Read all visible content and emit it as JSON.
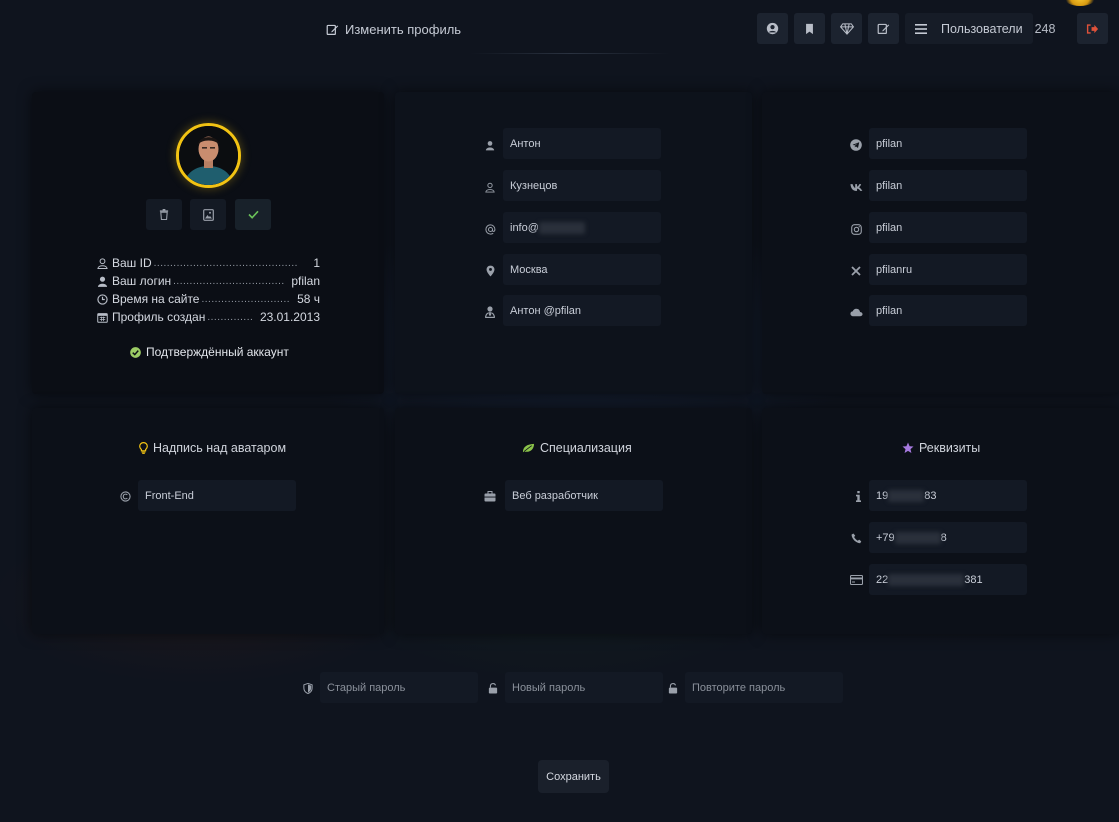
{
  "header": {
    "title": "Изменить профиль",
    "users_label": "Пользователи",
    "users_count": "248"
  },
  "profile": {
    "info": [
      {
        "label": "Ваш ID",
        "dots": "............................................",
        "value": "1"
      },
      {
        "label": "Ваш логин",
        "dots": "..................................",
        "value": "pfilan"
      },
      {
        "label": "Время на сайте",
        "dots": "...........................",
        "value": "58  ч"
      },
      {
        "label": "Профиль создан",
        "dots": "..............",
        "value": "23.01.2013"
      }
    ],
    "verified": "Подтверждённый аккаунт"
  },
  "personal": {
    "first_name": "Антон",
    "last_name": "Кузнецов",
    "email_prefix": "info@",
    "city": "Москва",
    "display_name": "Антон @pfilan"
  },
  "social": {
    "telegram": "pfilan",
    "vk": "pfilan",
    "instagram": "pfilan",
    "x": "pfilanru",
    "cloud": "pfilan"
  },
  "sections": {
    "avatar_caption_title": "Надпись над аватаром",
    "avatar_caption_value": "Front-End",
    "specialization_title": "Специализация",
    "specialization_value": "Веб разработчик",
    "requisites_title": "Реквизиты",
    "req_inn_start": "19",
    "req_inn_end": "83",
    "req_phone_start": "+79",
    "req_phone_end": "8",
    "req_card_start": "22",
    "req_card_end": "381"
  },
  "password": {
    "old_placeholder": "Старый пароль",
    "new_placeholder": "Новый пароль",
    "repeat_placeholder": "Повторите пароль"
  },
  "save_label": "Сохранить",
  "colors": {
    "accent_gold": "#f2c313",
    "verified_green": "#9ccc65",
    "leaf_green": "#8bc34a",
    "star_purple": "#a77ae0",
    "logout_red": "#e0523a"
  }
}
